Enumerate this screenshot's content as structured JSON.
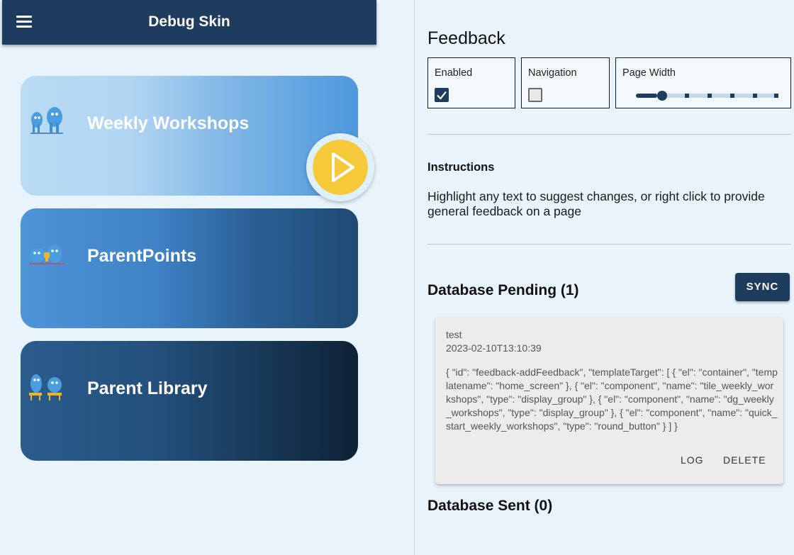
{
  "appbar": {
    "title": "Debug Skin"
  },
  "tiles": [
    {
      "label": "Weekly Workshops"
    },
    {
      "label": "ParentPoints"
    },
    {
      "label": "Parent Library"
    }
  ],
  "feedback": {
    "heading": "Feedback",
    "options": [
      {
        "label": "Enabled",
        "checked": true
      },
      {
        "label": "Navigation",
        "checked": false
      },
      {
        "label": "Page Width",
        "slider_value_fraction": 0.15
      }
    ],
    "instructions_title": "Instructions",
    "instructions_text": "Highlight any text to suggest changes, or right click to provide general feedback on a page"
  },
  "pending": {
    "heading": "Database Pending (1)",
    "sync_label": "SYNC",
    "entry": {
      "title": "test",
      "timestamp": "2023-02-10T13:10:39",
      "body": "{ \"id\": \"feedback-addFeedback\", \"templateTarget\": [ { \"el\": \"container\", \"templatename\": \"home_screen\" }, { \"el\": \"component\", \"name\": \"tile_weekly_workshops\", \"type\": \"display_group\" }, { \"el\": \"component\", \"name\": \"dg_weekly_workshops\", \"type\": \"display_group\" }, { \"el\": \"component\", \"name\": \"quick_start_weekly_workshops\", \"type\": \"round_button\" } ] }",
      "log_label": "LOG",
      "delete_label": "DELETE"
    }
  },
  "sent": {
    "heading": "Database Sent (0)"
  },
  "colors": {
    "primary": "#1d3c5e",
    "accent": "#f6c93a",
    "background": "#e9f3fb"
  }
}
